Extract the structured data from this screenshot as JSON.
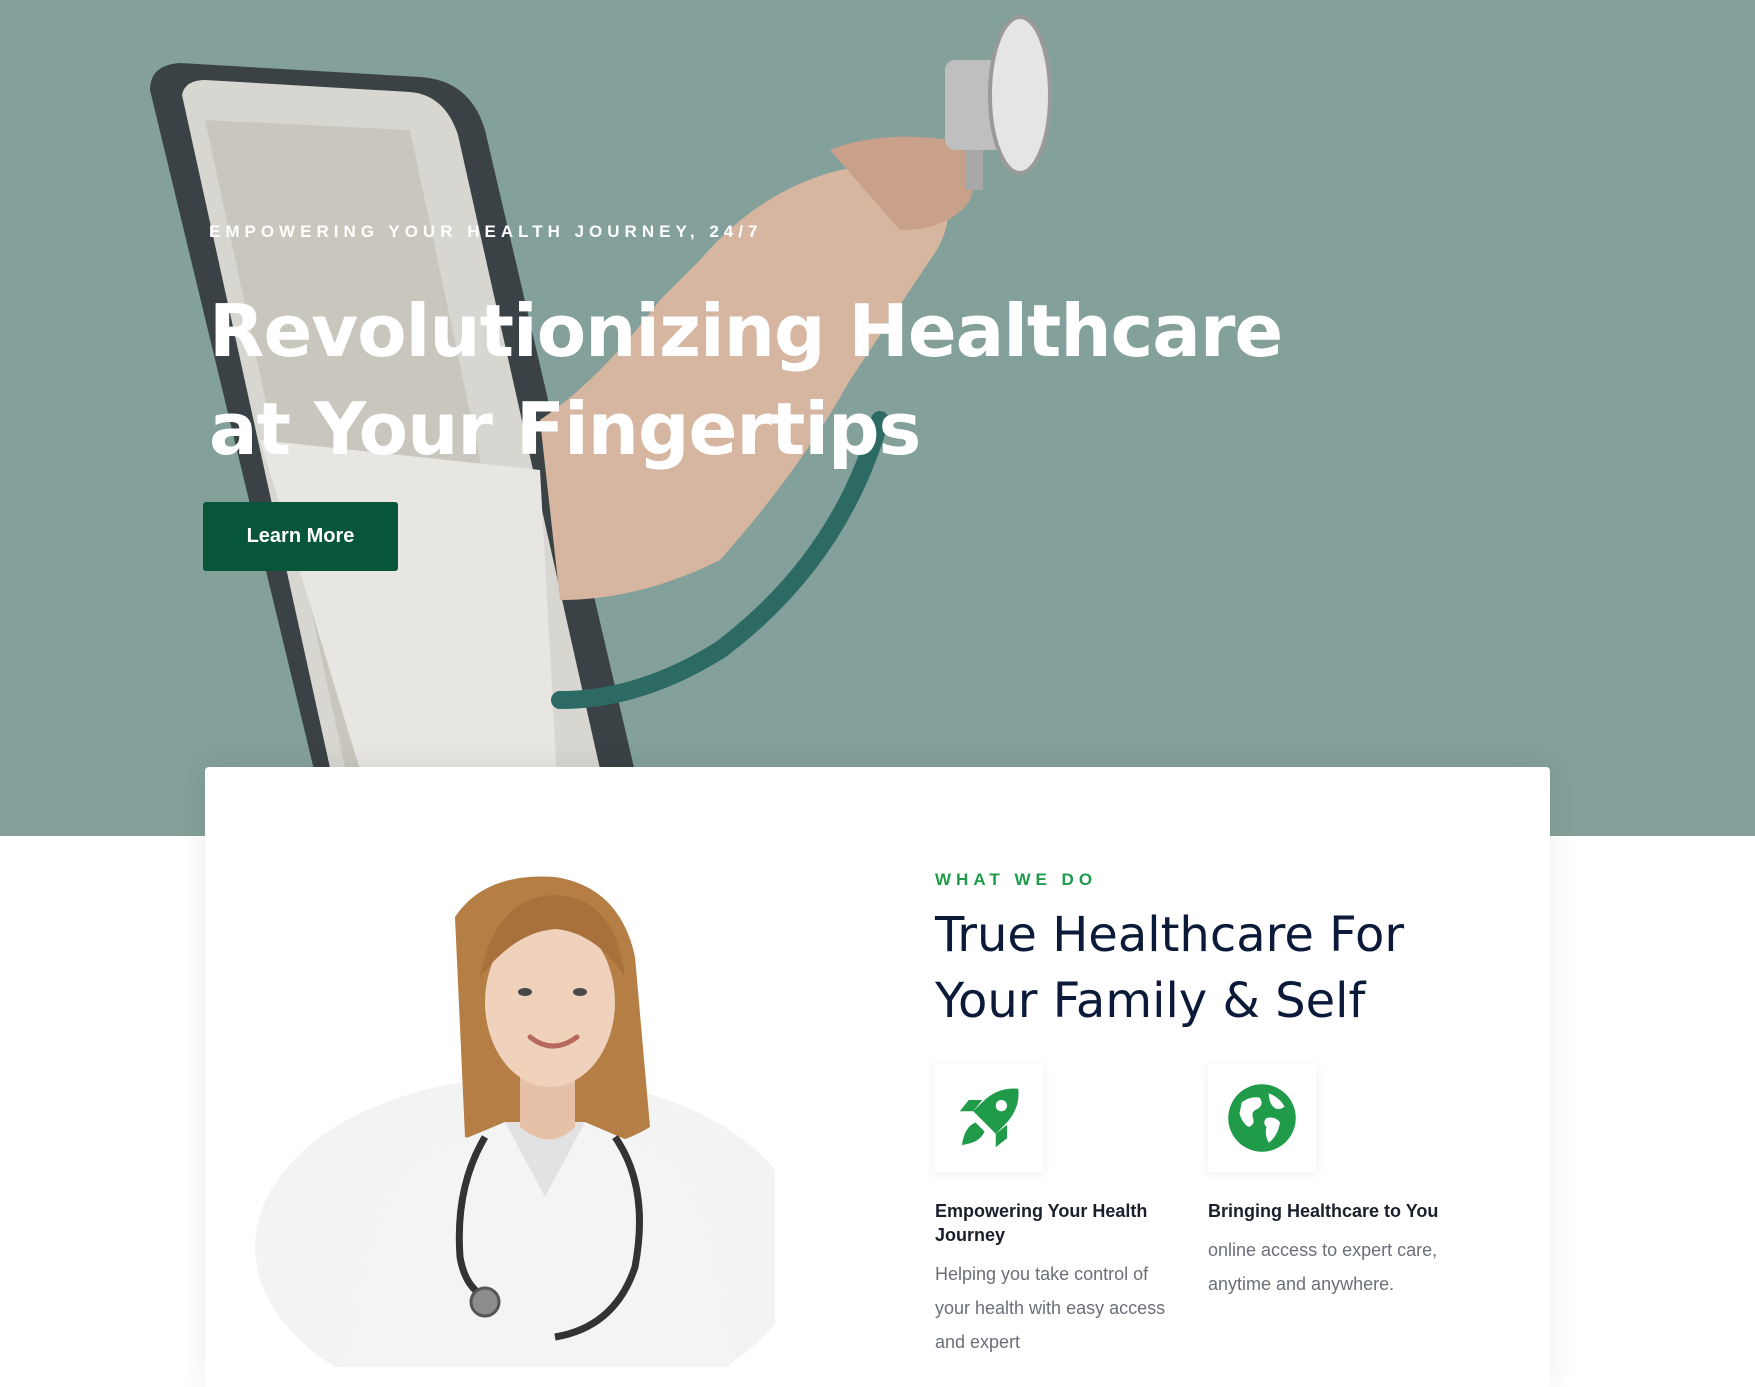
{
  "hero": {
    "eyebrow": "EMPOWERING YOUR HEALTH JOURNEY, 24/7",
    "title_line1": "Revolutionizing Healthcare",
    "title_line2": "at Your Fingertips",
    "cta_label": "Learn More",
    "background_color": "#83a09a",
    "button_color": "#085639"
  },
  "about": {
    "eyebrow": "WHAT WE DO",
    "title_line1": "True Healthcare For",
    "title_line2": "Your Family & Self",
    "features": [
      {
        "icon": "rocket-icon",
        "title": "Empowering Your Health Journey",
        "text": "Helping you take control of your health with easy access and expert"
      },
      {
        "icon": "globe-icon",
        "title": "Bringing Healthcare to You",
        "text": "online access to expert care, anytime and anywhere."
      }
    ],
    "accent_color": "#1f9b4a",
    "heading_color": "#0c1a3a"
  }
}
